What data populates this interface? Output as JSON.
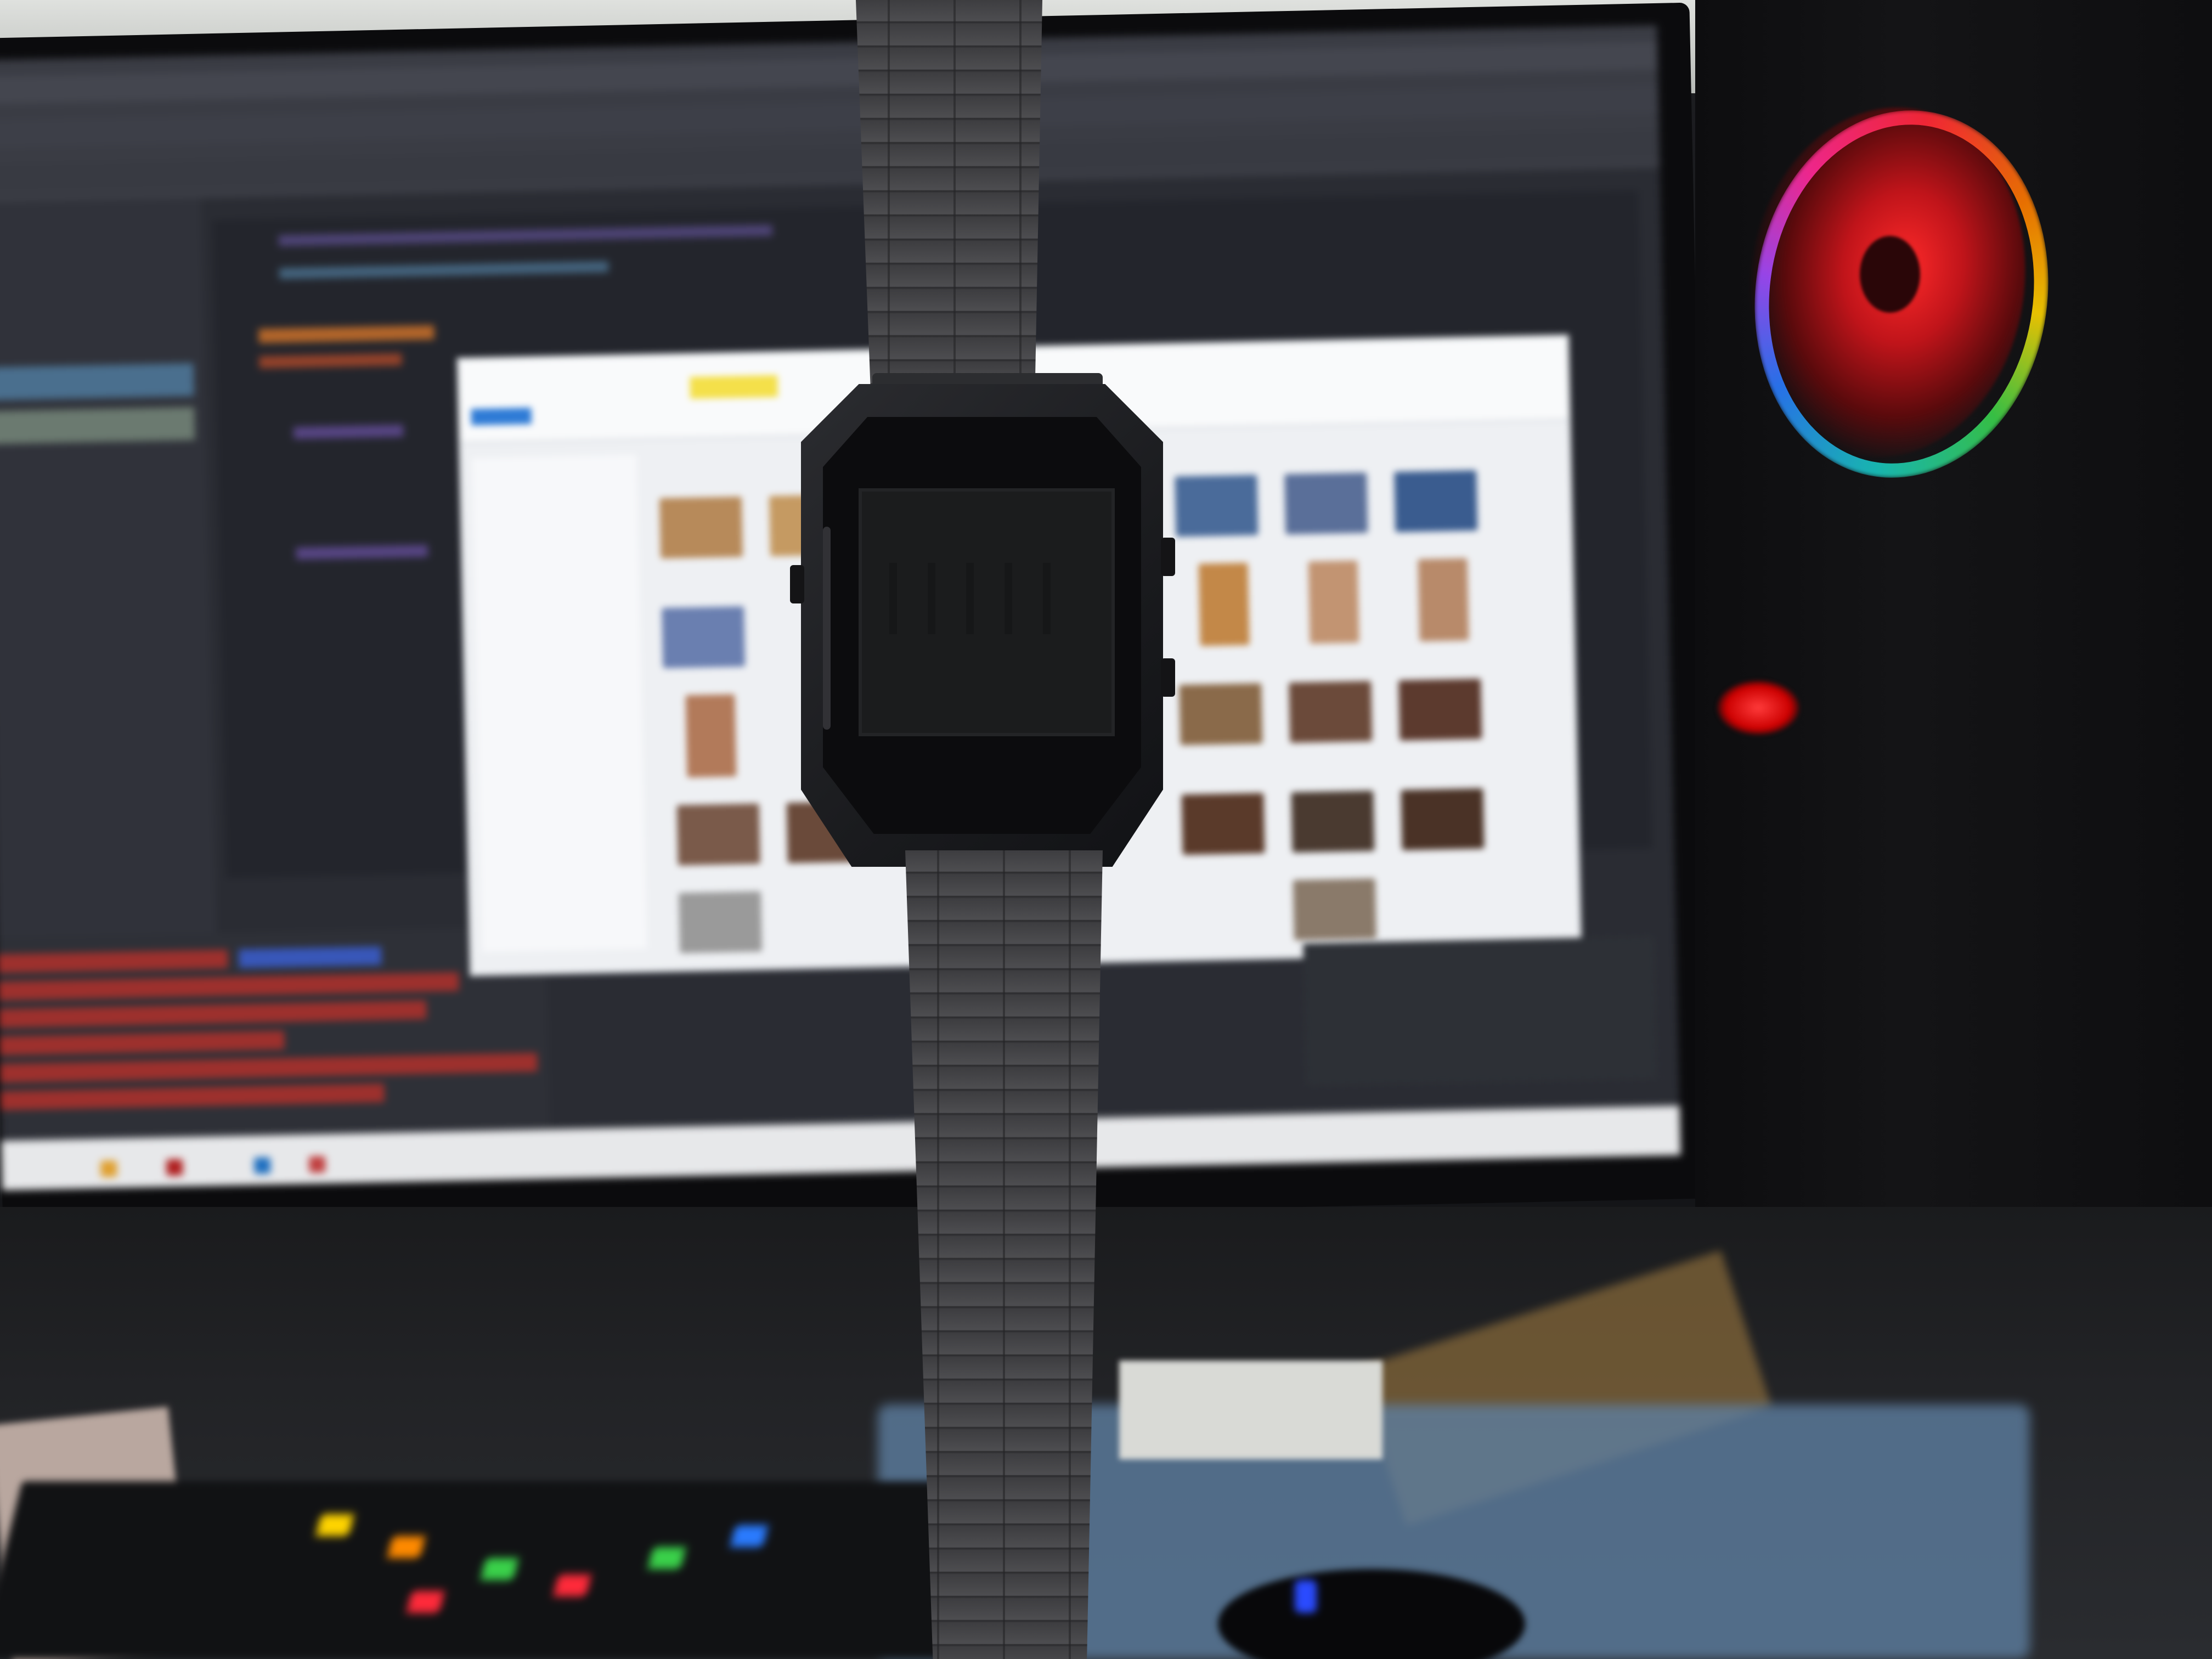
{
  "scene": {
    "description_colors": {
      "wall": "#dfe1de",
      "monitor_bezel": "#0b0b0d",
      "screen_bg": "#2a2c33",
      "error_text": "#b0302c",
      "explorer_bg": "#eef0f3",
      "pc_case": "#0d0d0f",
      "fan_glow": "#ff2a2a",
      "watch_metal": "#3d3d40",
      "lcd": "#1b1c1d",
      "desk_mat": "#5d7ea0"
    },
    "icons": {
      "fan": "rgb-fan-icon",
      "watch": "digital-watch-icon"
    }
  }
}
